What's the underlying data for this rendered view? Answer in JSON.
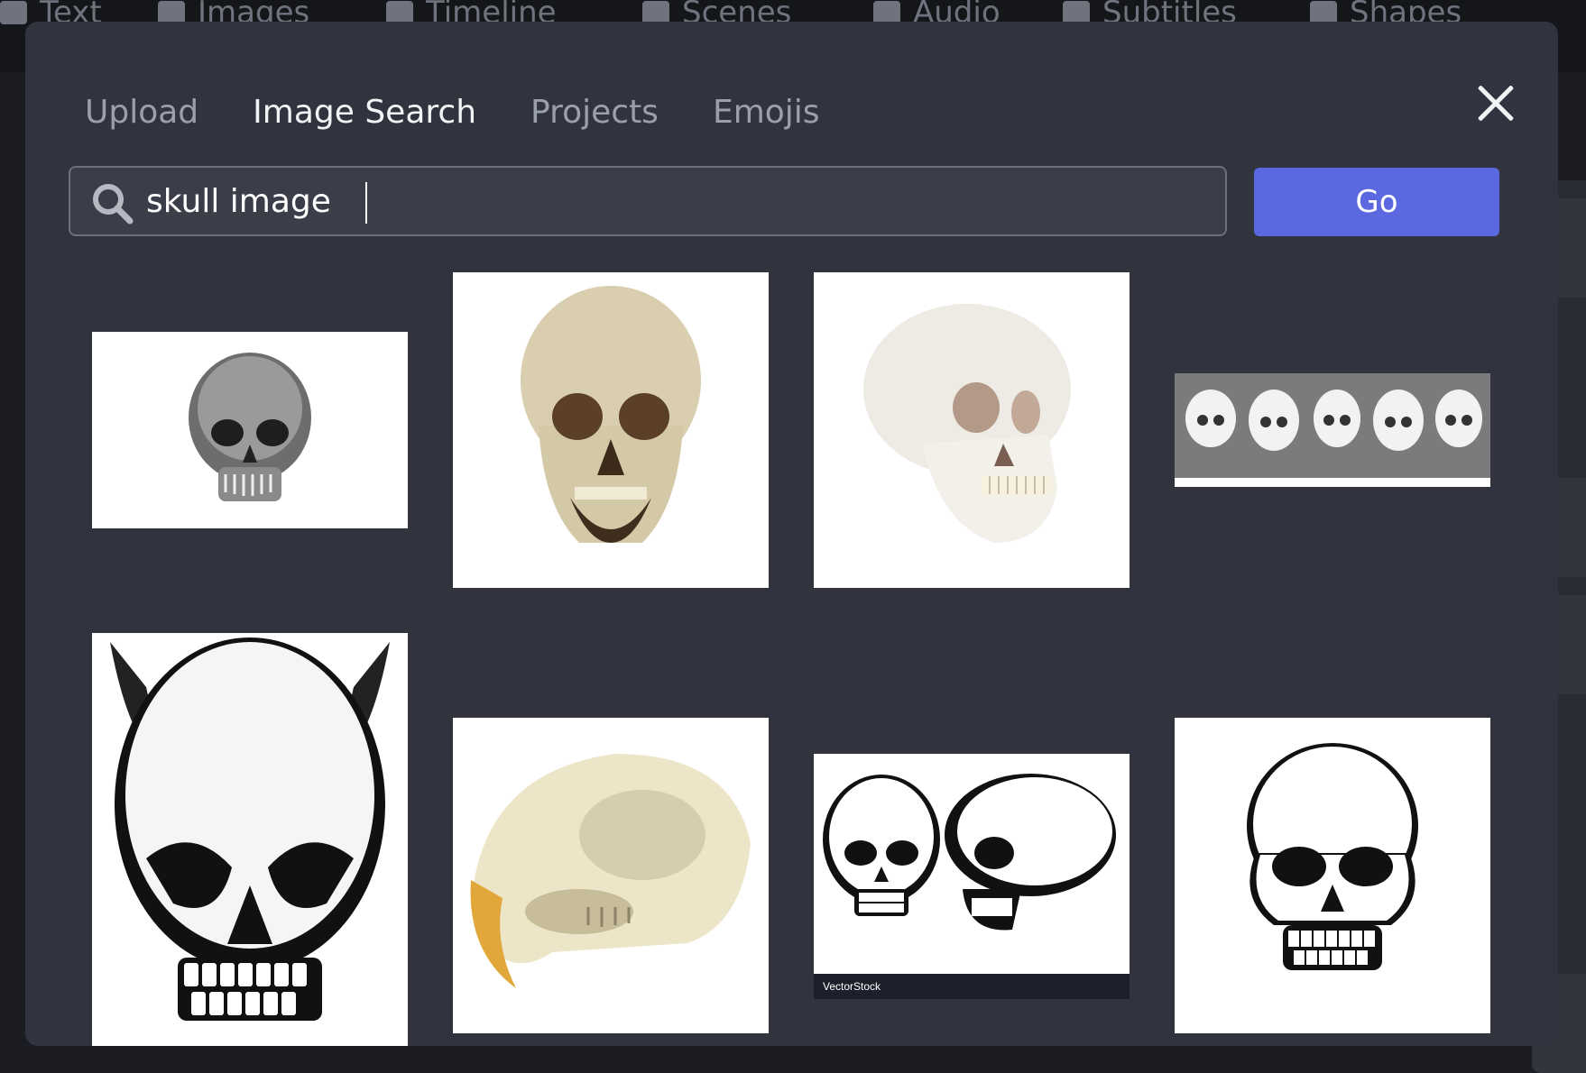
{
  "background_toolbar": {
    "tabs": [
      "Text",
      "Images",
      "Timeline",
      "Scenes",
      "Audio",
      "Subtitles",
      "Shapes"
    ]
  },
  "modal": {
    "tabs": [
      {
        "label": "Upload",
        "active": false
      },
      {
        "label": "Image Search",
        "active": true
      },
      {
        "label": "Projects",
        "active": false
      },
      {
        "label": "Emojis",
        "active": false
      }
    ],
    "close_icon": "close-icon",
    "search": {
      "icon": "search-icon",
      "value": "skull image",
      "button_label": "Go"
    },
    "results": [
      {
        "description": "grayscale human skull front view"
      },
      {
        "description": "aged human skull front view"
      },
      {
        "description": "white anatomical skull model three-quarter view"
      },
      {
        "description": "row of five skull drawings"
      },
      {
        "description": "horned demon skull illustration"
      },
      {
        "description": "beaver skull with orange teeth"
      },
      {
        "description": "two cartoon skulls front and side",
        "watermark": "VectorStock"
      },
      {
        "description": "hand drawn skull line art"
      }
    ]
  },
  "colors": {
    "modal_bg": "#31343f",
    "go_button": "#5b68df",
    "active_tab": "#f2f3f5",
    "inactive_tab": "#9aa0ab"
  }
}
